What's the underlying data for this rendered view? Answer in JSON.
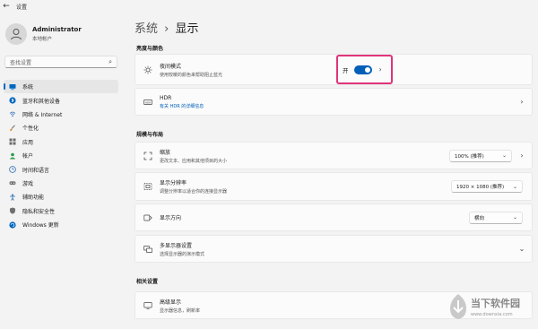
{
  "window": {
    "title": "设置"
  },
  "account": {
    "name": "Administrator",
    "type": "本地帐户"
  },
  "search": {
    "placeholder": "查找设置"
  },
  "nav": [
    {
      "label": "系统",
      "icon": "monitor-icon",
      "active": true
    },
    {
      "label": "蓝牙和其他设备",
      "icon": "bluetooth-icon"
    },
    {
      "label": "网络 & Internet",
      "icon": "wifi-icon"
    },
    {
      "label": "个性化",
      "icon": "brush-icon"
    },
    {
      "label": "应用",
      "icon": "apps-icon"
    },
    {
      "label": "帐户",
      "icon": "person-icon"
    },
    {
      "label": "时间和语言",
      "icon": "globe-clock-icon"
    },
    {
      "label": "游戏",
      "icon": "gamepad-icon"
    },
    {
      "label": "辅助功能",
      "icon": "accessibility-icon"
    },
    {
      "label": "隐私和安全性",
      "icon": "shield-icon"
    },
    {
      "label": "Windows 更新",
      "icon": "update-icon"
    }
  ],
  "breadcrumb": {
    "parent": "系统",
    "separator": "›",
    "current": "显示"
  },
  "sections": {
    "brightness": "亮度与颜色",
    "scale_layout": "规模与布局",
    "related": "相关设置"
  },
  "cards": {
    "night_light": {
      "title": "夜间模式",
      "subtitle": "使用较暖的颜色来帮助阻止蓝光",
      "toggle_label": "开",
      "toggle_on": true
    },
    "hdr": {
      "title": "HDR",
      "subtitle": "有关 HDR 的详细信息"
    },
    "scale": {
      "title": "缩放",
      "subtitle": "更改文本、应用和其他项目的大小",
      "value": "100% (推荐)"
    },
    "resolution": {
      "title": "显示分辨率",
      "subtitle": "调整分辨率以适合你的连接显示器",
      "value": "1920 × 1080 (推荐)"
    },
    "orientation": {
      "title": "显示方向",
      "value": "横向"
    },
    "multi": {
      "title": "多显示器设置",
      "subtitle": "选择显示器的演示模式"
    },
    "advanced": {
      "title": "高级显示",
      "subtitle": "显示器信息，刷新率"
    }
  },
  "watermark": {
    "title": "当下软件园",
    "url": "www.downxia.com"
  },
  "colors": {
    "accent": "#005fb8",
    "highlight": "#e0347a",
    "background": "#f3f3f3",
    "card": "#fbfbfb"
  }
}
